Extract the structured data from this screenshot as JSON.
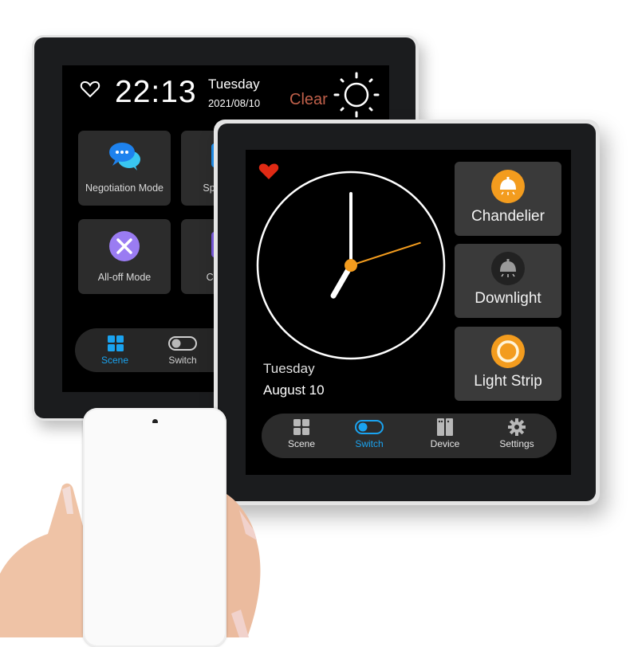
{
  "back_panel": {
    "time": "22:13",
    "day": "Tuesday",
    "date": "2021/08/10",
    "weather": "Clear",
    "icons": {
      "favorite": "heart-outline-icon",
      "weather": "sun-icon"
    },
    "tiles": [
      {
        "label": "Negotiation Mode",
        "icon": "chat-bubbles-icon",
        "color": "#1e90f0"
      },
      {
        "label": "Spee",
        "icon": "speech-icon",
        "color": "#1e90f0"
      },
      {
        "label": "All-off Mode",
        "icon": "close-circle-icon",
        "color": "#9a7cf2"
      },
      {
        "label": "Custo",
        "icon": "custom-icon",
        "color": "#7a5ae0"
      }
    ],
    "nav": [
      {
        "label": "Scene",
        "active": true
      },
      {
        "label": "Switch",
        "active": false
      }
    ]
  },
  "front_panel": {
    "analog_clock": {
      "hour": 7,
      "minute": 0,
      "second": 12
    },
    "day": "Tuesday",
    "date": "August 10",
    "devices": [
      {
        "label": "Chandelier",
        "state": "on",
        "icon": "chandelier-icon"
      },
      {
        "label": "Downlight",
        "state": "off",
        "icon": "downlight-icon"
      },
      {
        "label": "Light Strip",
        "state": "on",
        "icon": "light-strip-icon"
      }
    ],
    "nav": [
      {
        "label": "Scene",
        "active": false
      },
      {
        "label": "Switch",
        "active": true
      },
      {
        "label": "Device",
        "active": false
      },
      {
        "label": "Settings",
        "active": false
      }
    ]
  },
  "colors": {
    "accent_orange": "#f39c1e",
    "accent_blue": "#1aa3f0",
    "heart_red": "#e02a14",
    "weather_text": "#c0604a",
    "tile_bg": "#3a3a3a"
  }
}
